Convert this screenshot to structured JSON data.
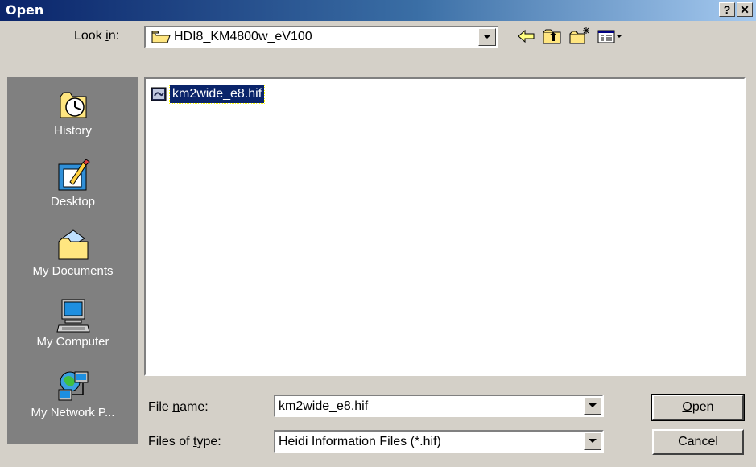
{
  "window": {
    "title": "Open",
    "help_label": "?",
    "close_label": "✕"
  },
  "lookin": {
    "label_pre": "Look ",
    "label_key": "i",
    "label_post": "n:",
    "value": "HDI8_KM4800w_eV100"
  },
  "toolbar": {
    "back_icon": "back-arrow-icon",
    "up_icon": "up-folder-icon",
    "new_icon": "new-folder-icon",
    "view_icon": "view-menu-icon"
  },
  "places": [
    {
      "label": "History",
      "icon": "history-icon"
    },
    {
      "label": "Desktop",
      "icon": "desktop-icon"
    },
    {
      "label": "My Documents",
      "icon": "my-documents-icon"
    },
    {
      "label": "My Computer",
      "icon": "my-computer-icon"
    },
    {
      "label": "My Network P...",
      "icon": "my-network-places-icon"
    }
  ],
  "files": [
    {
      "name": "km2wide_e8.hif",
      "selected": true
    }
  ],
  "filename": {
    "label_pre": "File ",
    "label_key": "n",
    "label_post": "ame:",
    "value": "km2wide_e8.hif"
  },
  "filetype": {
    "label_pre": "Files of ",
    "label_key": "t",
    "label_post": "ype:",
    "value": "Heidi Information Files (*.hif)"
  },
  "buttons": {
    "open_key": "O",
    "open_rest": "pen",
    "cancel": "Cancel"
  }
}
